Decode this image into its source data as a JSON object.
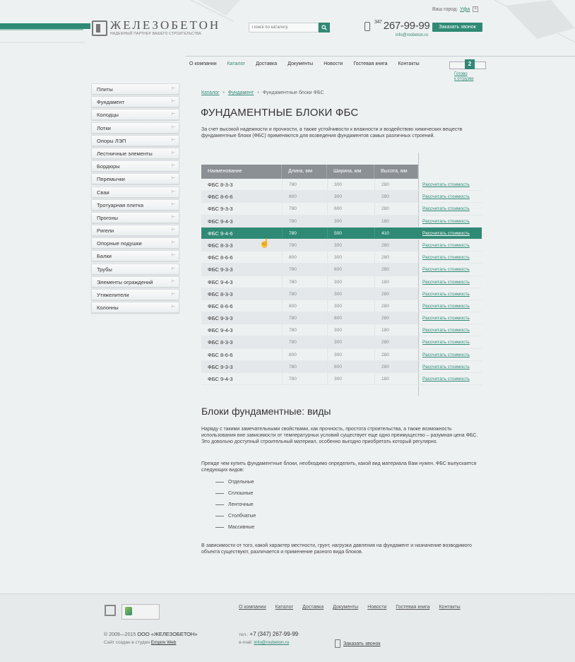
{
  "header": {
    "brand_title": "ЖЕЛЕЗОБЕТОН",
    "brand_tagline": "НАДЕЖНЫЙ ПАРТНЕР ВАШЕГО СТРОИТЕЛЬСТВА",
    "city_label": "Ваш город:",
    "city_value": "Уфа",
    "search_placeholder": "Поиск по каталогу",
    "phone_code": "347",
    "phone_number": "267-99-99",
    "email": "info@rosbeton.ru",
    "callback_label": "Заказать звонок"
  },
  "nav": {
    "items": [
      "О компании",
      "Каталог",
      "Доставка",
      "Документы",
      "Новости",
      "Гостевая книга",
      "Контакты"
    ],
    "active": "Каталог"
  },
  "cart": {
    "count": "2",
    "label_line1": "Готово",
    "label_line2": "к отгрузке"
  },
  "sidebar": {
    "items": [
      "Плиты",
      "Фундамент",
      "Колодцы",
      "Лотки",
      "Опоры ЛЭП",
      "Лестничные элементы",
      "Бордюры",
      "Перемычки",
      "Сваи",
      "Тротуарная плитка",
      "Прогоны",
      "Ригели",
      "Опорные подушки",
      "Балки",
      "Трубы",
      "Элементы ограждений",
      "Утяжелители",
      "Колонны"
    ]
  },
  "breadcrumb": {
    "items": [
      "Каталог",
      "Фундамент",
      "Фундаментные блоки ФБС"
    ]
  },
  "page_title": "ФУНДАМЕНТНЫЕ БЛОКИ ФБС",
  "intro": "За счет высокой надежности и прочности, а также устойчивости к влажности и воздействию химических веществ фундаментные блоки (ФБС) применяются для возведения фундаментов самых различных строений.",
  "table": {
    "headers": [
      "Наименование",
      "Длина, мм",
      "Ширина, мм",
      "Высота, мм"
    ],
    "action_label": "Рассчитать стоимость",
    "selected_index": 4,
    "rows": [
      [
        "ФБС 8-3-3",
        "780",
        "300",
        "280"
      ],
      [
        "ФБС 8-6-6",
        "800",
        "300",
        "280"
      ],
      [
        "ФБС 9-3-3",
        "780",
        "600",
        "280"
      ],
      [
        "ФБС 9-4-3",
        "780",
        "300",
        "180"
      ],
      [
        "ФБС 9-4-6",
        "780",
        "500",
        "410"
      ],
      [
        "ФБС 8-3-3",
        "780",
        "300",
        "280"
      ],
      [
        "ФБС 8-6-6",
        "800",
        "300",
        "280"
      ],
      [
        "ФБС 9-3-3",
        "780",
        "600",
        "280"
      ],
      [
        "ФБС 9-4-3",
        "780",
        "300",
        "180"
      ],
      [
        "ФБС 8-3-3",
        "780",
        "300",
        "280"
      ],
      [
        "ФБС 8-6-6",
        "800",
        "300",
        "280"
      ],
      [
        "ФБС 9-3-3",
        "780",
        "600",
        "280"
      ],
      [
        "ФБС 9-4-3",
        "780",
        "300",
        "180"
      ],
      [
        "ФБС 8-3-3",
        "780",
        "300",
        "280"
      ],
      [
        "ФБС 8-6-6",
        "800",
        "300",
        "280"
      ],
      [
        "ФБС 9-3-3",
        "780",
        "600",
        "280"
      ],
      [
        "ФБС 9-4-3",
        "780",
        "300",
        "180"
      ]
    ]
  },
  "section2": {
    "title": "Блоки фундаментные: виды",
    "para1": "Наряду с такими замечательными свойствами, как прочность, простота строительства, а также возможность использования вне зависимости от температурных условий существует еще одно преимущество – разумная цена ФБС. Это довольно доступный строительный материал, особенно выгодно приобретать который регулярно.",
    "para2": "Прежде чем купить фундаментные блоки, необходимо определить, какой вид материала Вам нужен. ФБС выпускается следующих видов:",
    "list": [
      "Отдельные",
      "Сплошные",
      "Ленточные",
      "Столбчатые",
      "Массивные"
    ],
    "para3": "В зависимости от того, какой характер местности, грунт, нагрузка давления на фундамент и назначение возводимого объекта существуют, различается и применение разного вида блоков."
  },
  "footer": {
    "nav": [
      "О компании",
      "Каталог",
      "Доставка",
      "Документы",
      "Новости",
      "Гостевая книга",
      "Контакты"
    ],
    "copyright_years": "© 2009—2015",
    "company": "ООО «ЖЕЛЕЗОБЕТОН»",
    "made_by_label": "Сайт создан в студии",
    "made_by_link": "Empire Web",
    "tel_label": "тел.:",
    "tel": "+7 (347) 267-99-99",
    "email_label": "e-mail:",
    "email": "info@rosbeton.ru",
    "callback": "Заказать звонок"
  },
  "colors": {
    "accent": "#2f8a75",
    "table_header": "#8a9094",
    "background": "#eef1f2"
  }
}
